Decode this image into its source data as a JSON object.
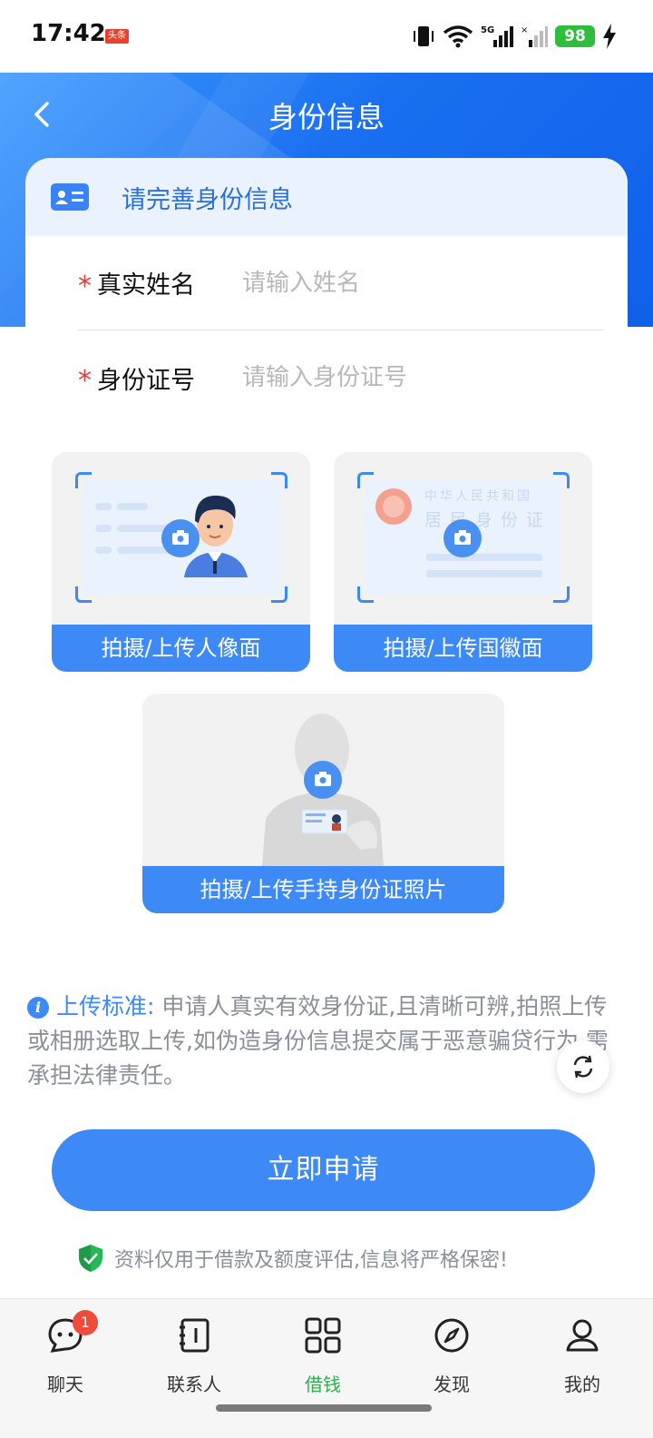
{
  "status_bar": {
    "time": "17:42",
    "app_badge": "头条",
    "network": "5G",
    "battery": "98",
    "icons": [
      "vibrate-icon",
      "wifi-icon",
      "signal-icon",
      "signal-off-icon",
      "charging-icon"
    ]
  },
  "header": {
    "title": "身份信息"
  },
  "card": {
    "title": "请完善身份信息",
    "fields": [
      {
        "required_mark": "*",
        "label": "真实姓名",
        "placeholder": "请输入姓名",
        "value": ""
      },
      {
        "required_mark": "*",
        "label": "身份证号",
        "placeholder": "请输入身份证号",
        "value": ""
      }
    ]
  },
  "uploads": {
    "portrait": {
      "label": "拍摄/上传人像面"
    },
    "emblem": {
      "label": "拍摄/上传国徽面",
      "card_text_line1": "中华人民共和国",
      "card_text_line2": "居民身份证"
    },
    "handheld": {
      "label": "拍摄/上传手持身份证照片"
    }
  },
  "notice": {
    "label": "上传标准:",
    "text": "申请人真实有效身份证,且清晰可辨,拍照上传或相册选取上传,如伪造身份信息提交属于恶意骗贷行为,需承担法律责任。"
  },
  "submit": {
    "label": "立即申请"
  },
  "privacy": {
    "text": "资料仅用于借款及额度评估,信息将严格保密!"
  },
  "bottom_nav": {
    "items": [
      {
        "label": "聊天",
        "icon": "chat-icon",
        "badge": "1",
        "active": false
      },
      {
        "label": "联系人",
        "icon": "contacts-icon",
        "active": false
      },
      {
        "label": "借钱",
        "icon": "grid-icon",
        "active": true
      },
      {
        "label": "发现",
        "icon": "compass-icon",
        "active": false
      },
      {
        "label": "我的",
        "icon": "profile-icon",
        "active": false
      }
    ]
  },
  "colors": {
    "primary": "#3d8af7",
    "header_gradient_start": "#3d9bff",
    "header_gradient_end": "#1060ea",
    "required": "#e53935",
    "nav_active": "#2bb24c",
    "badge": "#f04a3a"
  }
}
